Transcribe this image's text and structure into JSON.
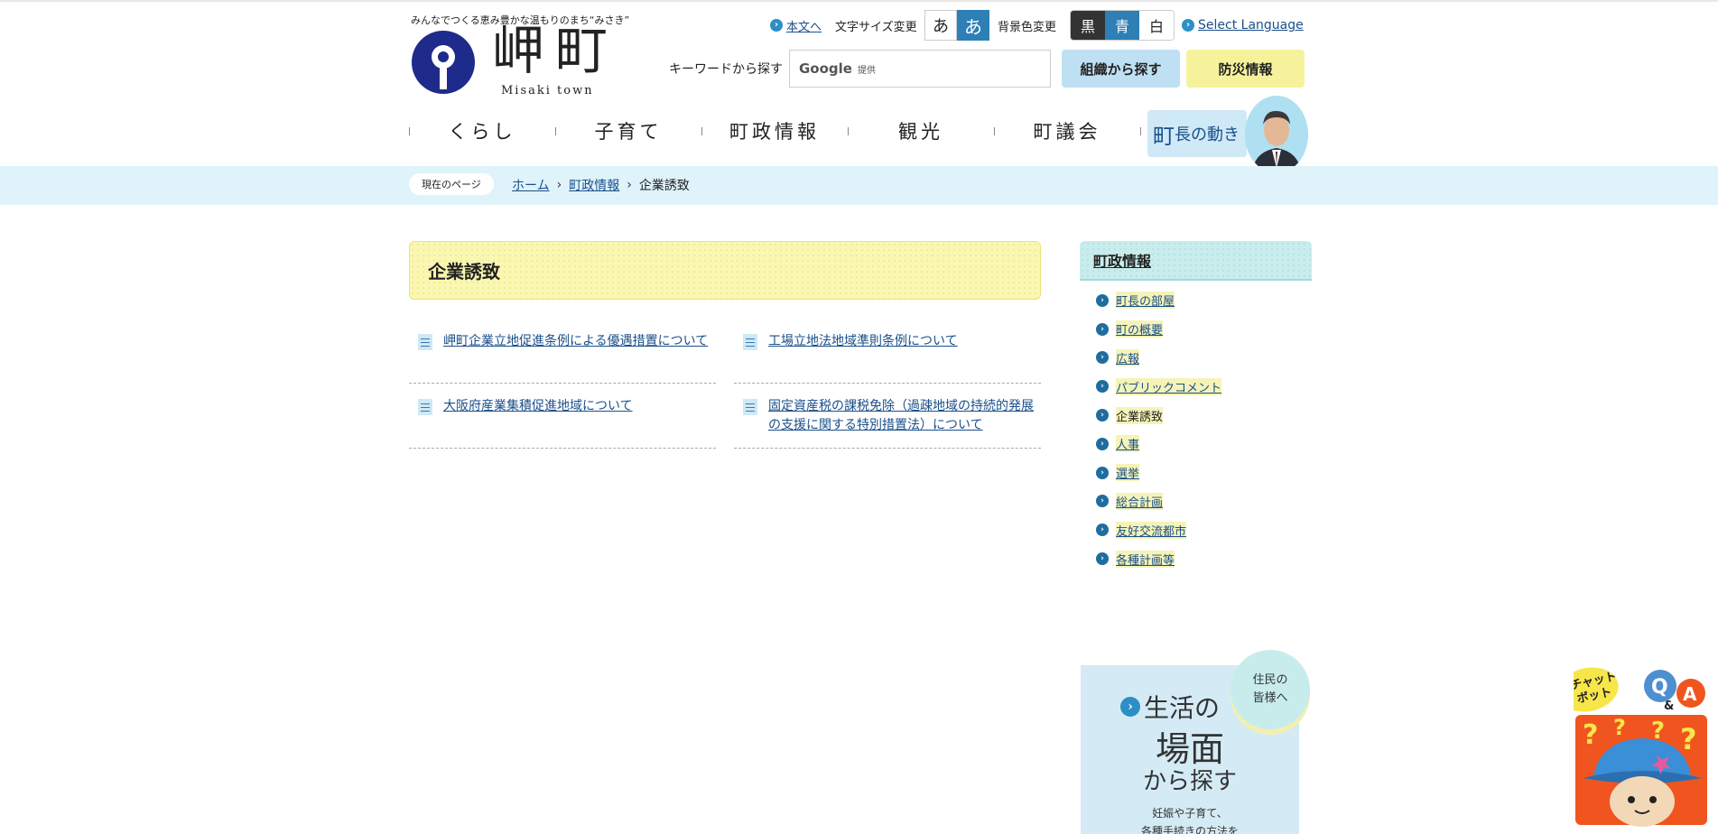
{
  "header": {
    "tagline": "みんなでつくる恵み豊かな温もりのまち“みさき”",
    "logo_jp": "岬町",
    "logo_en": "Misaki town",
    "skip_link": "本文へ",
    "font_size_label": "文字サイズ変更",
    "font_size_buttons": [
      "あ",
      "あ"
    ],
    "bg_color_label": "背景色変更",
    "bg_color_buttons": [
      "黒",
      "青",
      "白"
    ],
    "select_language": "Select Language",
    "keyword_label": "キーワードから探す",
    "search_brand": "Google",
    "search_provided": "提供",
    "org_search": "組織から探す",
    "disaster_info": "防災情報",
    "colors": {
      "accent": "#2d7fb6",
      "org_button": "#bfe0f3",
      "disaster_button": "#f6f29b"
    }
  },
  "nav": {
    "items": [
      "くらし",
      "子育て",
      "町政情報",
      "観光",
      "町議会"
    ],
    "mayor_big": "町",
    "mayor_rest": "長の動き"
  },
  "breadcrumb": {
    "label": "現在のページ",
    "home": "ホーム",
    "parent": "町政情報",
    "current": "企業誘致"
  },
  "main": {
    "title": "企業誘致",
    "links": [
      "岬町企業立地促進条例による優遇措置について",
      "工場立地法地域準則条例について",
      "大阪府産業集積促進地域について",
      "固定資産税の課税免除（過疎地域の持続的発展の支援に関する特別措置法）について"
    ]
  },
  "sidebar": {
    "title": "町政情報",
    "items": [
      "町長の部屋",
      "町の概要",
      "広報",
      "パブリックコメント",
      "企業誘致",
      "人事",
      "選挙",
      "総合計画",
      "友好交流都市",
      "各種計画等"
    ],
    "current_index": 4
  },
  "banner": {
    "badge_line1": "住民の",
    "badge_line2": "皆様へ",
    "line1": "生活の",
    "line2": "場面",
    "line3": "から探す",
    "line4": "妊娠や子育て、",
    "line5": "各種手続きの方法を"
  },
  "chatbot": {
    "label_line1": "チャット",
    "label_line2": "ボット",
    "q": "Q",
    "amp": "&",
    "a": "A",
    "marks": "?"
  }
}
